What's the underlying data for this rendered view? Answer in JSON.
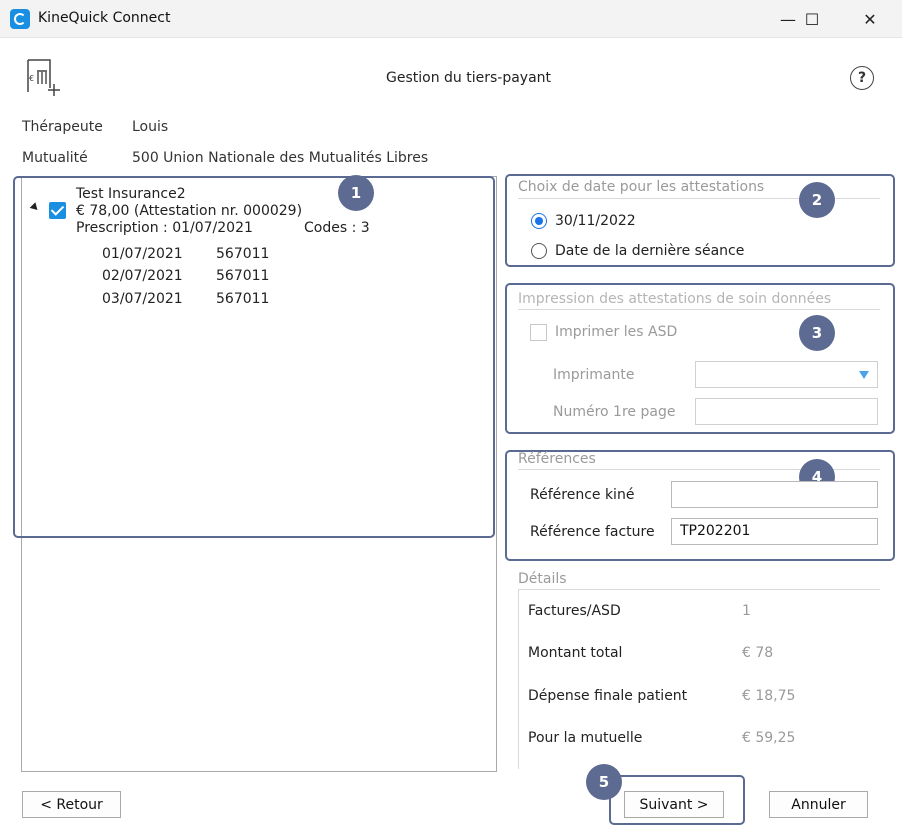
{
  "window": {
    "app_title": "KineQuick Connect",
    "minimize": "—",
    "maximize": "☐",
    "close": "✕"
  },
  "header": {
    "title": "Gestion du tiers-payant",
    "help": "?"
  },
  "info": {
    "therapist_label": "Thérapeute",
    "therapist_value": "Louis",
    "mutuality_label": "Mutualité",
    "mutuality_value": "500 Union Nationale des Mutualités Libres"
  },
  "tree": {
    "insurance": "Test Insurance2",
    "amount_line": "€ 78,00  (Attestation nr. 000029)",
    "prescription": "Prescription : 01/07/2021",
    "codes": "Codes : 3",
    "sessions": [
      {
        "date": "01/07/2021",
        "code": "567011"
      },
      {
        "date": "02/07/2021",
        "code": "567011"
      },
      {
        "date": "03/07/2021",
        "code": "567011"
      }
    ]
  },
  "date_choice": {
    "title": "Choix de date pour les attestations",
    "option1": "30/11/2022",
    "option2": "Date de la dernière séance"
  },
  "print": {
    "title": "Impression des attestations de soin données",
    "checkbox_label": "Imprimer les ASD",
    "printer_label": "Imprimante",
    "first_page_label": "Numéro 1re page"
  },
  "references": {
    "title": "Références",
    "kine_label": "Référence kiné",
    "kine_value": "",
    "invoice_label": "Référence facture",
    "invoice_value": "TP202201"
  },
  "details": {
    "title": "Détails",
    "rows": [
      {
        "label": "Factures/ASD",
        "value": "1"
      },
      {
        "label": "Montant total",
        "value": "€ 78"
      },
      {
        "label": "Dépense finale patient",
        "value": "€ 18,75"
      },
      {
        "label": "Pour la mutuelle",
        "value": "€ 59,25"
      }
    ]
  },
  "buttons": {
    "back": "< Retour",
    "next": "Suivant >",
    "cancel": "Annuler"
  },
  "badges": [
    "1",
    "2",
    "3",
    "4",
    "5"
  ],
  "colors": {
    "accent": "#1a8ee0",
    "badge": "#5d6b93",
    "highlight_border": "#5a6a93"
  }
}
